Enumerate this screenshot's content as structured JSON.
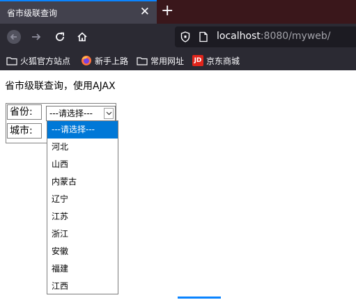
{
  "browser": {
    "tab_title": "省市级联查询",
    "close_symbol": "✕",
    "newtab_symbol": "+",
    "url_host": "localhost",
    "url_rest": ":8080/myweb/"
  },
  "bookmarks": [
    {
      "label": "火狐官方站点",
      "icon": "folder-icon"
    },
    {
      "label": "新手上路",
      "icon": "firefox-icon"
    },
    {
      "label": "常用网址",
      "icon": "folder-icon"
    },
    {
      "label": "京东商城",
      "icon": "jd-icon"
    }
  ],
  "bookmark_icon_text": {
    "jd": "JD"
  },
  "page": {
    "heading": "省市级联查询，使用AJAX",
    "province_label": "省份:",
    "city_label": "城市:",
    "select_value": "---请选择---",
    "options": [
      "---请选择---",
      "河北",
      "山西",
      "内蒙古",
      "辽宁",
      "江苏",
      "浙江",
      "安徽",
      "福建",
      "江西"
    ]
  },
  "colors": {
    "accent": "#0a84ff",
    "selected_option": "#0078d7",
    "toolbar": "#2b2a33"
  }
}
